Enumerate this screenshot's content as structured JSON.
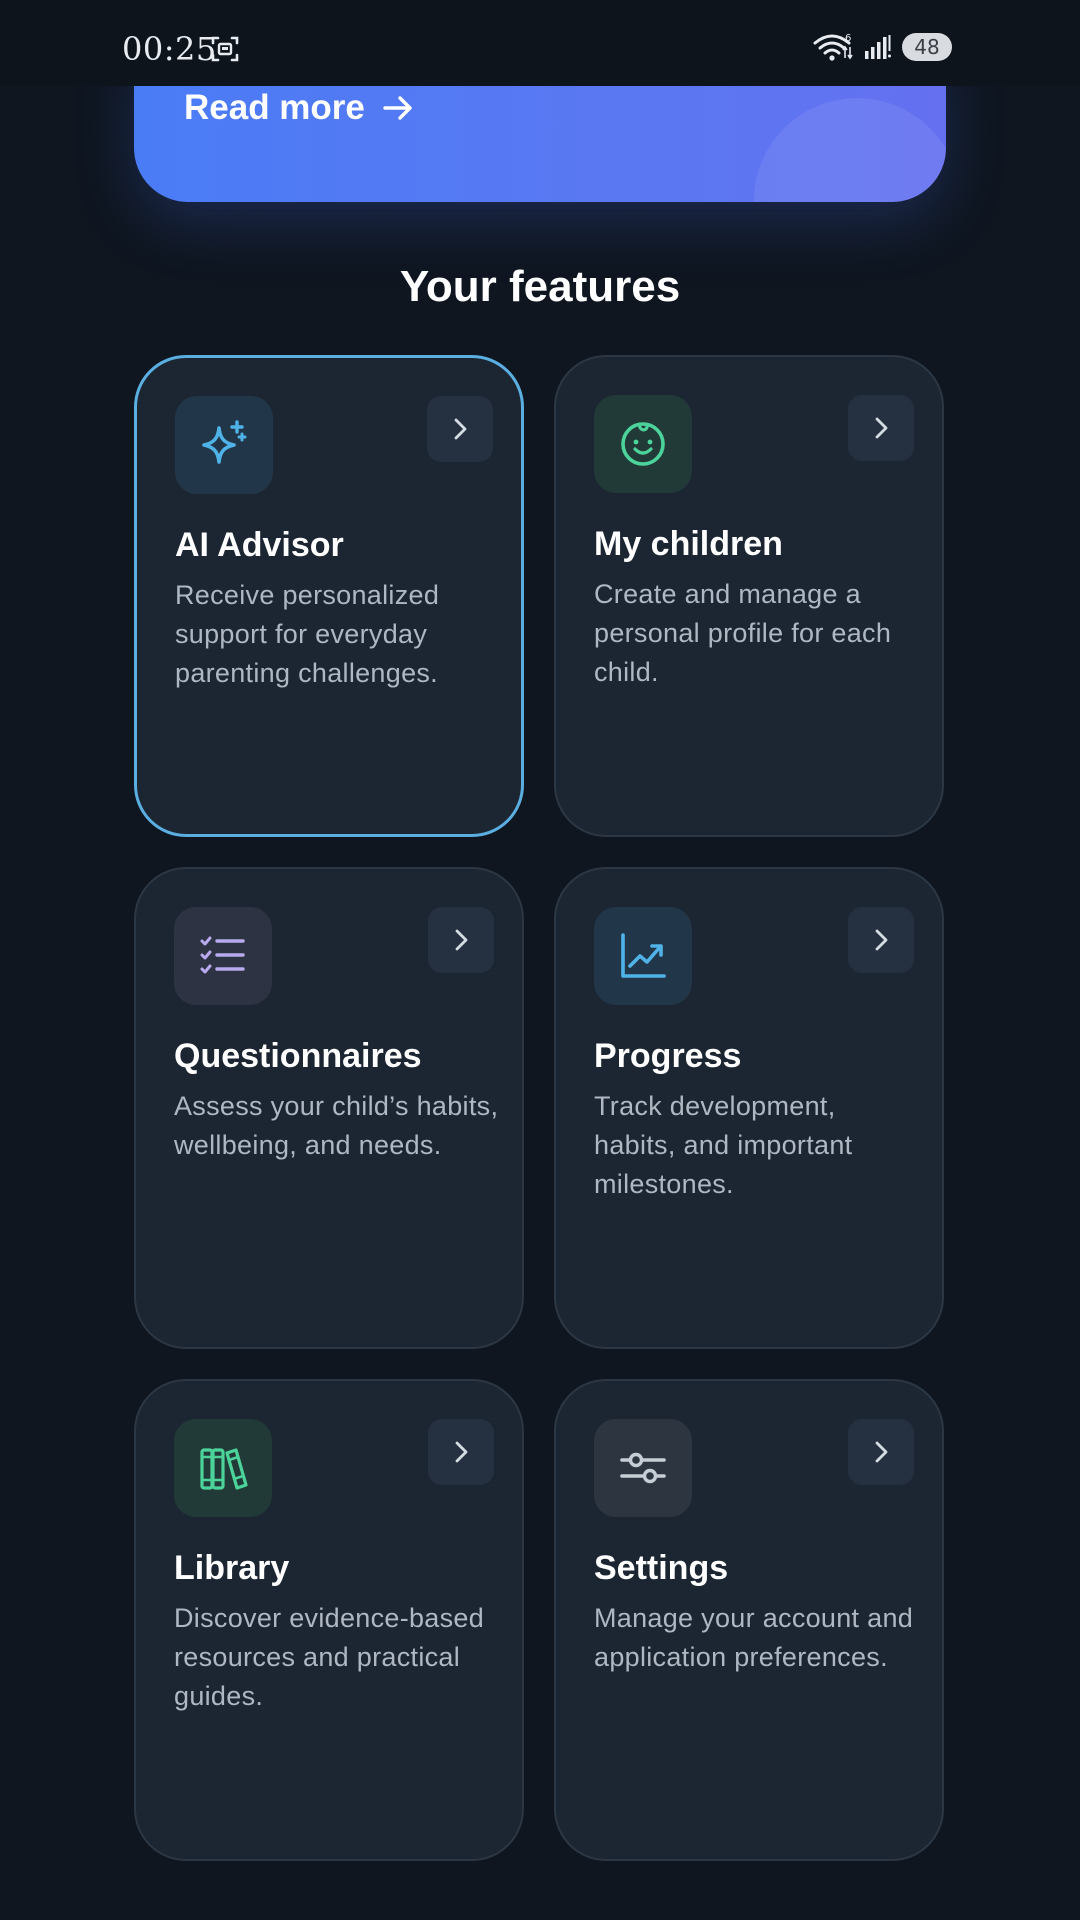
{
  "status_bar": {
    "time": "00:25",
    "battery": "48"
  },
  "hero": {
    "read_more_label": "Read more"
  },
  "section": {
    "title": "Your features"
  },
  "features": [
    {
      "title": "AI Advisor",
      "description": "Receive personalized support for everyday parenting challenges.",
      "icon": "sparkles-icon",
      "accent": "#4fb3e8",
      "selected": true
    },
    {
      "title": "My children",
      "description": "Create and manage a personal profile for each child.",
      "icon": "baby-face-icon",
      "accent": "#4cd39a"
    },
    {
      "title": "Questionnaires",
      "description": "Assess your child’s habits, wellbeing, and needs.",
      "icon": "checklist-icon",
      "accent": "#b9a9ee"
    },
    {
      "title": "Progress",
      "description": "Track development, habits, and important milestones.",
      "icon": "chart-trend-icon",
      "accent": "#4fb3e8"
    },
    {
      "title": "Library",
      "description": "Discover evidence-based resources and practical guides.",
      "icon": "books-icon",
      "accent": "#4cd39a"
    },
    {
      "title": "Settings",
      "description": "Manage your account and application preferences.",
      "icon": "sliders-icon",
      "accent": "#c8ced6"
    }
  ]
}
